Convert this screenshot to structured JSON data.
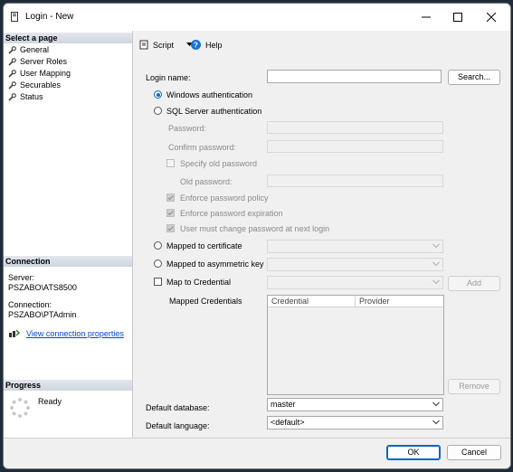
{
  "window": {
    "title": "Login - New"
  },
  "left": {
    "select_page_header": "Select a page",
    "pages": [
      "General",
      "Server Roles",
      "User Mapping",
      "Securables",
      "Status"
    ],
    "connection_header": "Connection",
    "server_label": "Server:",
    "server_value": "PSZABO\\ATS8500",
    "connection_label": "Connection:",
    "connection_value": "PSZABO\\PTAdmin",
    "view_connection_link": "View connection properties",
    "progress_header": "Progress",
    "progress_status": "Ready"
  },
  "toolbar": {
    "script_label": "Script",
    "help_label": "Help"
  },
  "form": {
    "login_name_label": "Login name:",
    "login_name_value": "",
    "search_button": "Search...",
    "windows_auth": "Windows authentication",
    "sql_auth": "SQL Server authentication",
    "password_label": "Password:",
    "confirm_password_label": "Confirm password:",
    "specify_old_password": "Specify old password",
    "old_password_label": "Old password:",
    "enforce_policy": "Enforce password policy",
    "enforce_expiration": "Enforce password expiration",
    "must_change": "User must change password at next login",
    "mapped_certificate": "Mapped to certificate",
    "mapped_asymmetric_key": "Mapped to asymmetric key",
    "map_to_credential": "Map to Credential",
    "add_button": "Add",
    "mapped_credentials_label": "Mapped Credentials",
    "credentials_columns": [
      "Credential",
      "Provider"
    ],
    "remove_button": "Remove",
    "default_database_label": "Default database:",
    "default_database_value": "master",
    "default_language_label": "Default language:",
    "default_language_value": "<default>"
  },
  "buttons": {
    "ok": "OK",
    "cancel": "Cancel"
  },
  "colors": {
    "accent": "#0a64c8",
    "link": "#0645d1"
  }
}
